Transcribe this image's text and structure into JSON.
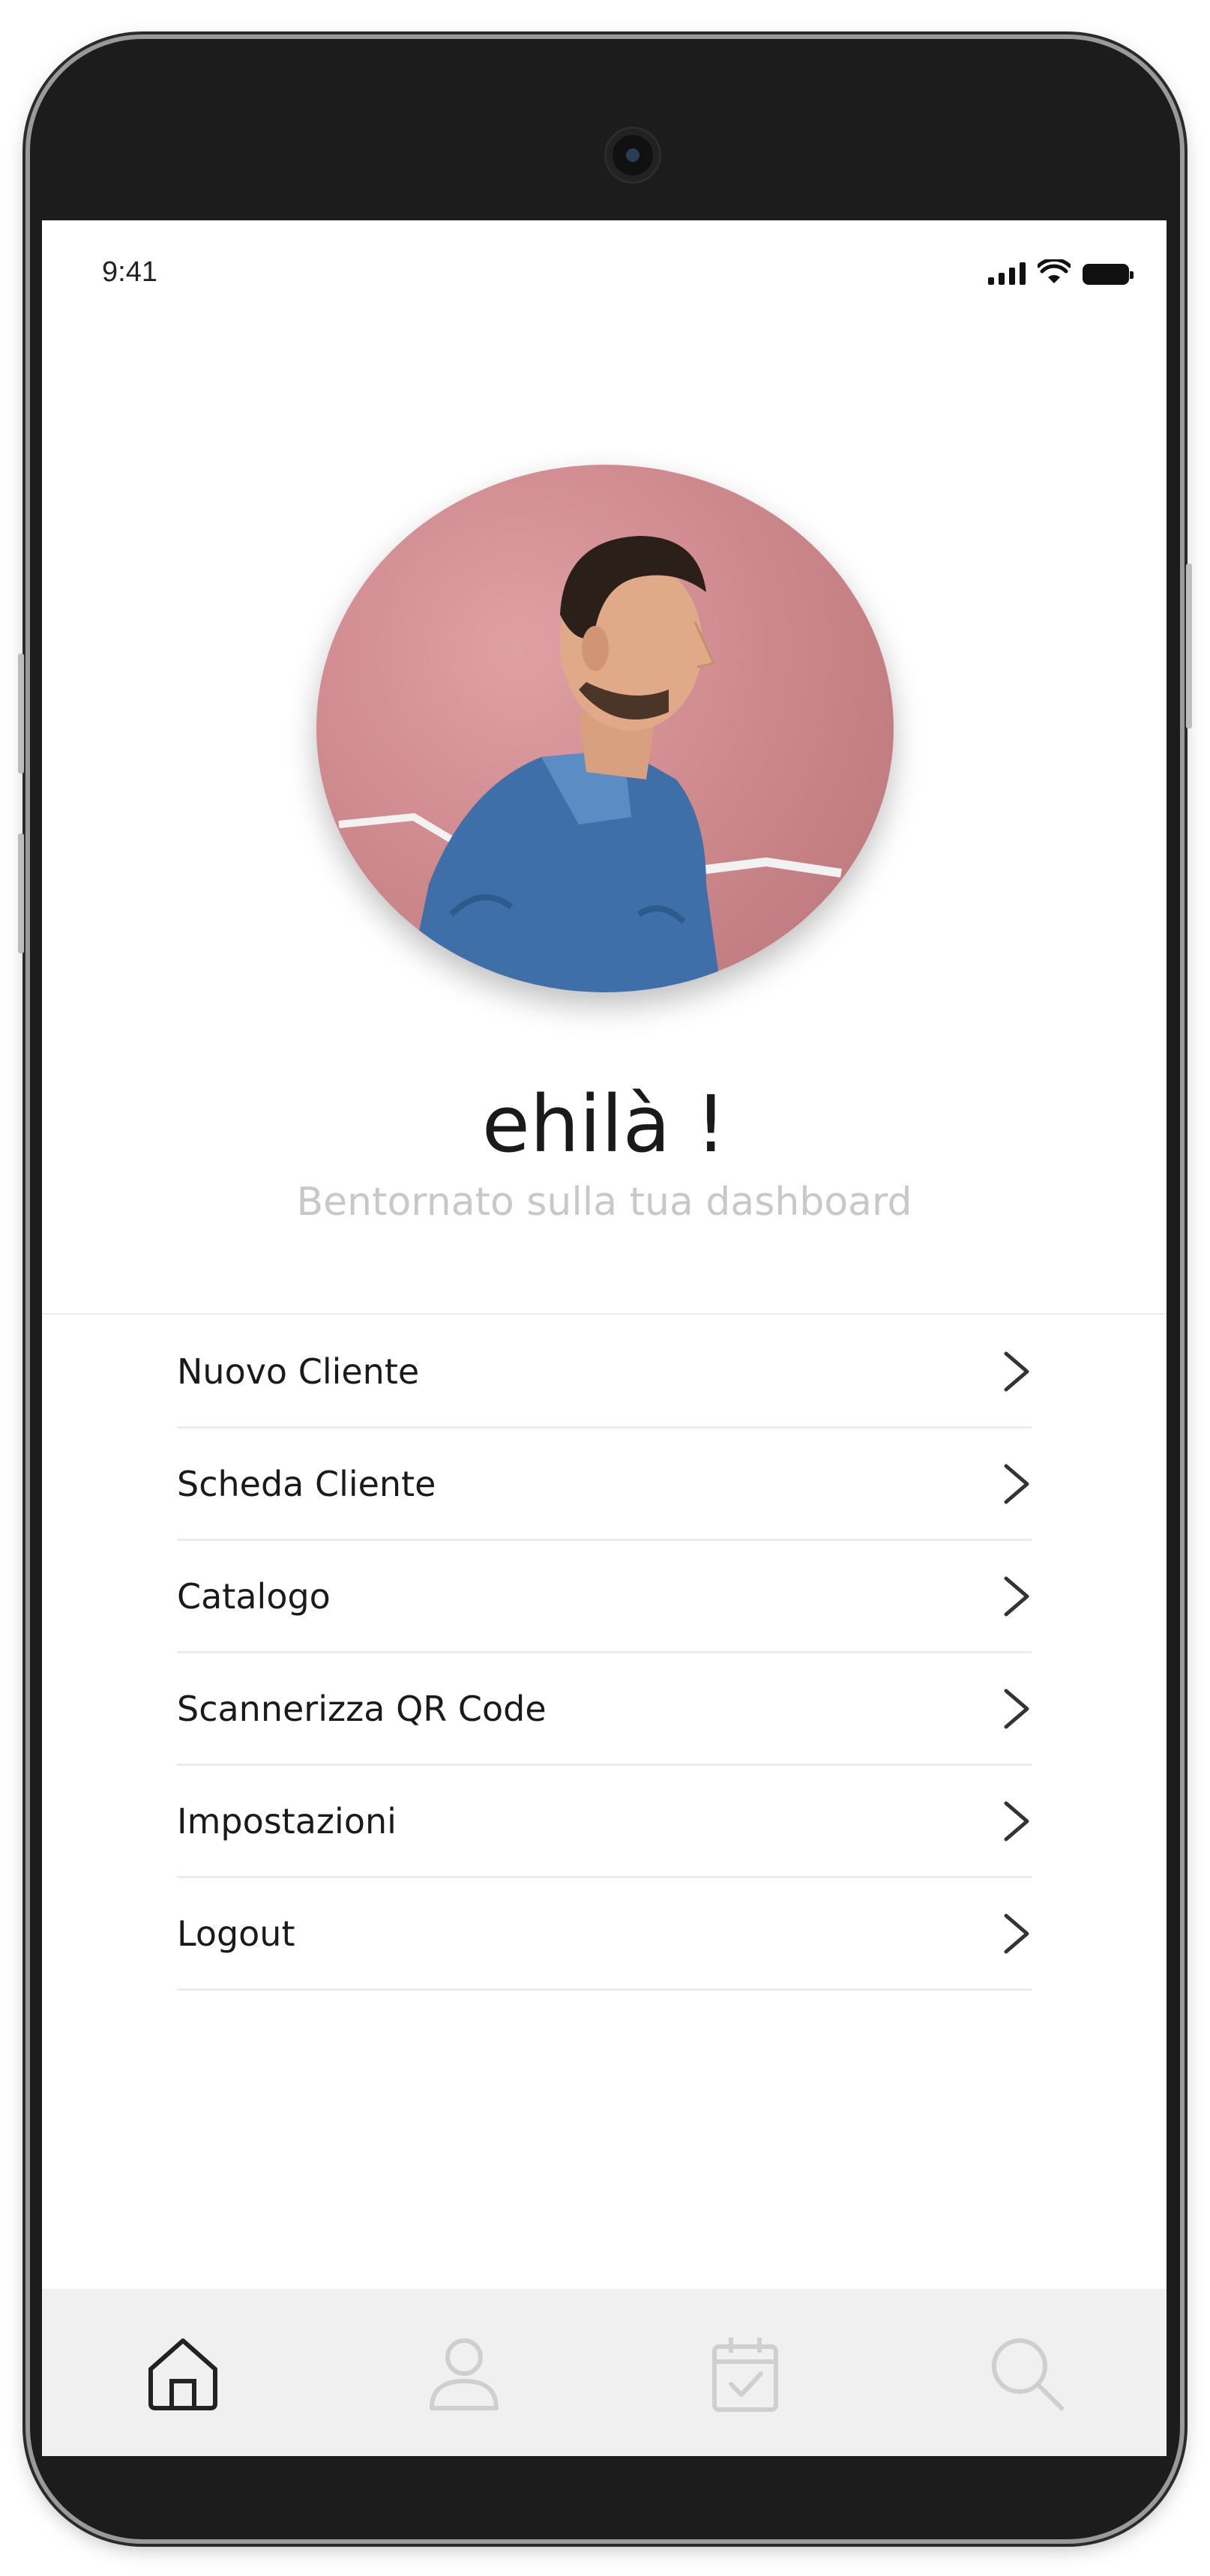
{
  "status_bar": {
    "time": "9:41"
  },
  "profile": {
    "image": "man-profile-photo"
  },
  "greeting": {
    "title": "ehilà !",
    "subtitle": "Bentornato sulla tua dashboard"
  },
  "menu": {
    "items": [
      {
        "label": "Nuovo Cliente",
        "icon": "chevron-right-icon"
      },
      {
        "label": "Scheda Cliente",
        "icon": "chevron-right-icon"
      },
      {
        "label": "Catalogo",
        "icon": "chevron-right-icon"
      },
      {
        "label": "Scannerizza QR Code",
        "icon": "chevron-right-icon"
      },
      {
        "label": "Impostazioni",
        "icon": "chevron-right-icon"
      },
      {
        "label": "Logout",
        "icon": "chevron-right-icon"
      }
    ]
  },
  "tab_bar": {
    "tabs": [
      {
        "icon": "home-icon",
        "active": true
      },
      {
        "icon": "user-icon",
        "active": false
      },
      {
        "icon": "calendar-check-icon",
        "active": false
      },
      {
        "icon": "search-icon",
        "active": false
      }
    ]
  },
  "colors": {
    "active_tab": "#222222",
    "inactive_tab": "#cfcfcf",
    "avatar_bg": "#cf8a8e"
  }
}
